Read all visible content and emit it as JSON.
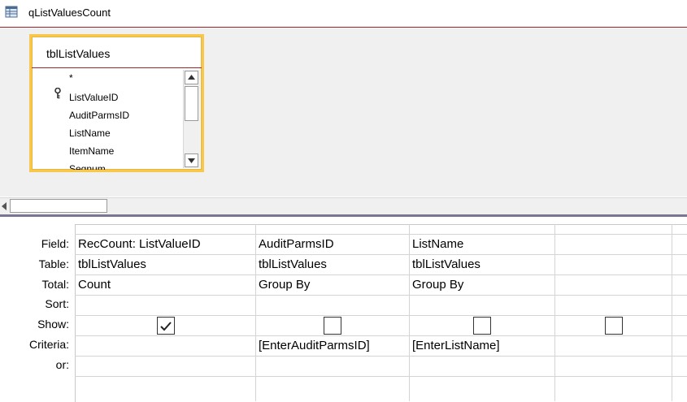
{
  "window": {
    "title": "qListValuesCount"
  },
  "table_pane": {
    "table_name": "tblListValues",
    "fields": [
      "*",
      "ListValueID",
      "AuditParmsID",
      "ListName",
      "ItemName",
      "Seqnum"
    ]
  },
  "grid": {
    "row_labels": [
      "Field:",
      "Table:",
      "Total:",
      "Sort:",
      "Show:",
      "Criteria:",
      "or:"
    ],
    "columns": [
      {
        "field": "RecCount: ListValueID",
        "table": "tblListValues",
        "total": "Count",
        "sort": "",
        "show": true,
        "criteria": ""
      },
      {
        "field": "AuditParmsID",
        "table": "tblListValues",
        "total": "Group By",
        "sort": "",
        "show": false,
        "criteria": "[EnterAuditParmsID]"
      },
      {
        "field": "ListName",
        "table": "tblListValues",
        "total": "Group By",
        "sort": "",
        "show": false,
        "criteria": "[EnterListName]"
      },
      {
        "field": "",
        "table": "",
        "total": "",
        "sort": "",
        "show": false,
        "criteria": ""
      }
    ]
  },
  "icons": {
    "title": "query-icon",
    "primary_key": "key-icon"
  },
  "colors": {
    "selection_border": "#f8c84c",
    "splitter": "#7a7596",
    "rule": "#a0252a"
  }
}
